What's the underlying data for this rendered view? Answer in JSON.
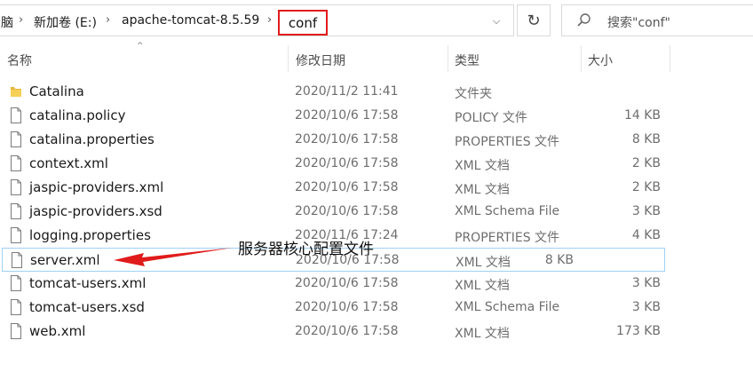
{
  "breadcrumb": {
    "items": [
      "脑",
      "新加卷 (E:)",
      "apache-tomcat-8.5.59"
    ],
    "current": "conf",
    "highlight_color": "#e01b1b"
  },
  "search": {
    "placeholder": "搜索\"conf\""
  },
  "columns": {
    "name": "名称",
    "date": "修改日期",
    "type": "类型",
    "size": "大小"
  },
  "files": [
    {
      "name": "Catalina",
      "date": "2020/11/2 11:41",
      "type": "文件夹",
      "size": "",
      "icon": "folder-icon"
    },
    {
      "name": "catalina.policy",
      "date": "2020/10/6 17:58",
      "type": "POLICY 文件",
      "size": "14 KB",
      "icon": "file-icon"
    },
    {
      "name": "catalina.properties",
      "date": "2020/10/6 17:58",
      "type": "PROPERTIES 文件",
      "size": "8 KB",
      "icon": "file-icon"
    },
    {
      "name": "context.xml",
      "date": "2020/10/6 17:58",
      "type": "XML 文档",
      "size": "2 KB",
      "icon": "file-icon"
    },
    {
      "name": "jaspic-providers.xml",
      "date": "2020/10/6 17:58",
      "type": "XML 文档",
      "size": "2 KB",
      "icon": "file-icon"
    },
    {
      "name": "jaspic-providers.xsd",
      "date": "2020/10/6 17:58",
      "type": "XML Schema File",
      "size": "3 KB",
      "icon": "file-icon"
    },
    {
      "name": "logging.properties",
      "date": "2020/11/6 17:24",
      "type": "PROPERTIES 文件",
      "size": "4 KB",
      "icon": "file-icon"
    },
    {
      "name": "server.xml",
      "date": "2020/10/6 17:58",
      "type": "XML 文档",
      "size": "8 KB",
      "icon": "file-icon",
      "selected": true
    },
    {
      "name": "tomcat-users.xml",
      "date": "2020/10/6 17:58",
      "type": "XML 文档",
      "size": "3 KB",
      "icon": "file-icon"
    },
    {
      "name": "tomcat-users.xsd",
      "date": "2020/10/6 17:58",
      "type": "XML Schema File",
      "size": "3 KB",
      "icon": "file-icon"
    },
    {
      "name": "web.xml",
      "date": "2020/10/6 17:58",
      "type": "XML 文档",
      "size": "173 KB",
      "icon": "file-icon"
    }
  ],
  "annotation": {
    "text": "服务器核心配置文件",
    "arrow_color": "#e01b1b"
  }
}
